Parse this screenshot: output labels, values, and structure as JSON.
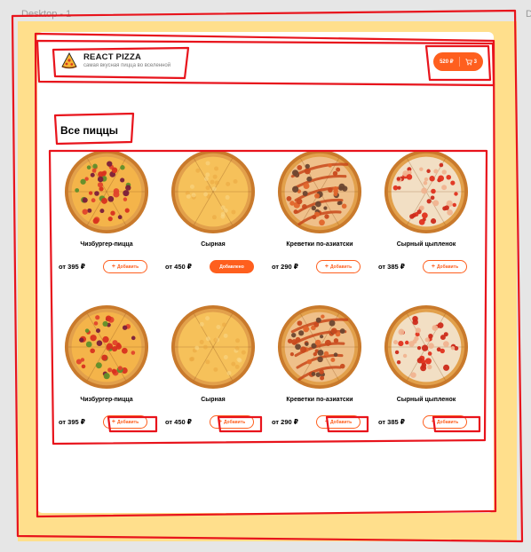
{
  "frame": {
    "label": "Desktop - 1",
    "right_label": "D"
  },
  "header": {
    "logo_title": "REACT PIZZA",
    "logo_subtitle": "самая вкусная пицца во вселенной",
    "cart": {
      "sum": "520 ₽",
      "count": "3"
    }
  },
  "section_title": "Все пиццы",
  "accent_color": "#fe5f1e",
  "background_color": "#ffdf8c",
  "pizzas": [
    {
      "name": "Чизбургер-пицца",
      "price": "от 395 ₽",
      "button": "Добавить",
      "active": false,
      "style": "cheeseburger"
    },
    {
      "name": "Сырная",
      "price": "от 450 ₽",
      "button": "Добавлено",
      "active": true,
      "style": "cheese"
    },
    {
      "name": "Креветки по-азиатски",
      "price": "от 290 ₽",
      "button": "Добавить",
      "active": false,
      "style": "shrimp"
    },
    {
      "name": "Сырный цыпленок",
      "price": "от 385 ₽",
      "button": "Добавить",
      "active": false,
      "style": "chicken"
    },
    {
      "name": "Чизбургер-пицца",
      "price": "от 395 ₽",
      "button": "Добавить",
      "active": false,
      "style": "cheeseburger"
    },
    {
      "name": "Сырная",
      "price": "от 450 ₽",
      "button": "Добавить",
      "active": false,
      "style": "cheese"
    },
    {
      "name": "Креветки по-азиатски",
      "price": "от 290 ₽",
      "button": "Добавить",
      "active": false,
      "style": "shrimp"
    },
    {
      "name": "Сырный цыпленок",
      "price": "от 385 ₽",
      "button": "Добавить",
      "active": false,
      "style": "chicken"
    }
  ]
}
